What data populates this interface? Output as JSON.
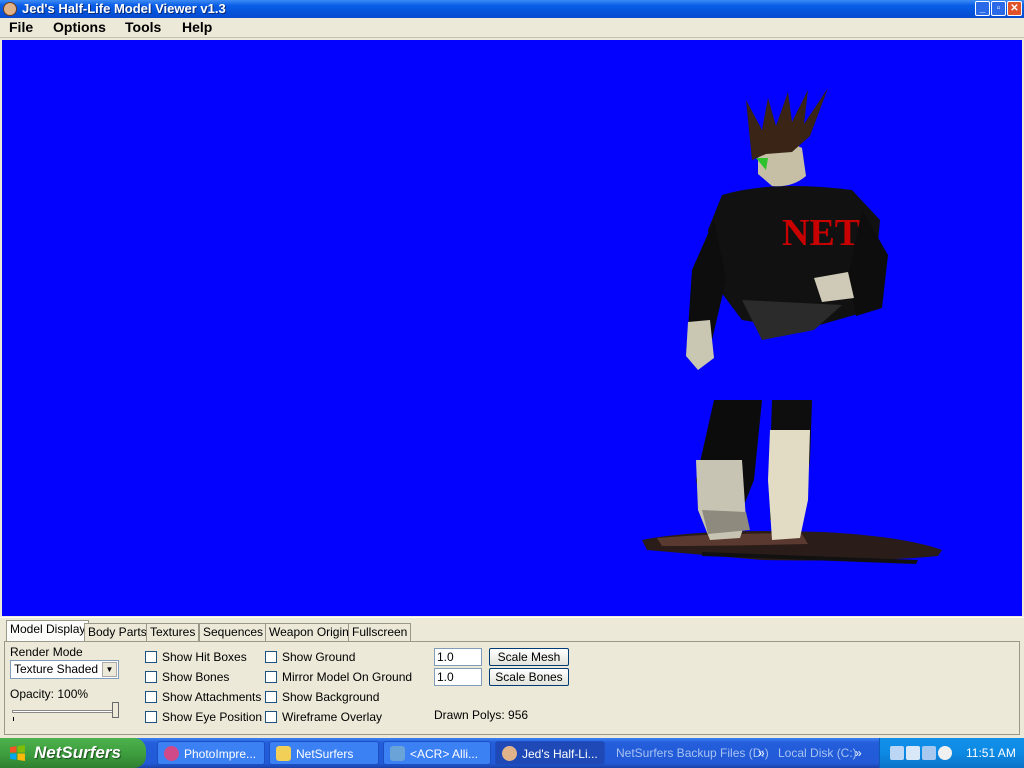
{
  "window": {
    "title": "Jed's Half-Life Model Viewer v1.3"
  },
  "menu": [
    "File",
    "Options",
    "Tools",
    "Help"
  ],
  "viewport": {
    "background": "#0202fe",
    "model_logo_text": "NET"
  },
  "tabs": [
    "Model Display",
    "Body Parts",
    "Textures",
    "Sequences",
    "Weapon Origin",
    "Fullscreen"
  ],
  "model_display": {
    "render_mode_label": "Render Mode",
    "render_mode_value": "Texture Shaded",
    "opacity_label": "Opacity: 100%",
    "opacity_value": 100,
    "checkboxes_col1": [
      "Show Hit Boxes",
      "Show Bones",
      "Show Attachments",
      "Show Eye Position"
    ],
    "checkboxes_col2": [
      "Show Ground",
      "Mirror Model On Ground",
      "Show Background",
      "Wireframe Overlay"
    ],
    "scale_mesh_value": "1.0",
    "scale_bones_value": "1.0",
    "scale_mesh_label": "Scale Mesh",
    "scale_bones_label": "Scale Bones",
    "drawn_polys": "Drawn Polys: 956"
  },
  "taskbar": {
    "start_label": "NetSurfers",
    "tasks": [
      "PhotoImpre...",
      "NetSurfers",
      "<ACR> Alli...",
      "Jed's Half-Li..."
    ],
    "quick_links": [
      "NetSurfers Backup Files (D:)",
      "Local Disk (C:)"
    ],
    "clock": "11:51 AM"
  }
}
